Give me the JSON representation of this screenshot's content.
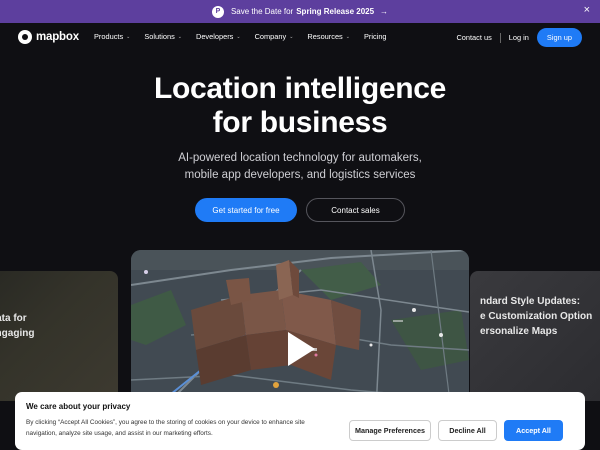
{
  "banner": {
    "badge": "P",
    "text": "Save the Date for",
    "highlight": "Spring Release 2025",
    "arrow": "→",
    "close": "×"
  },
  "nav": {
    "brand": "mapbox",
    "items": [
      {
        "label": "Products",
        "caret": "⌄"
      },
      {
        "label": "Solutions",
        "caret": "⌄"
      },
      {
        "label": "Developers",
        "caret": "⌄"
      },
      {
        "label": "Company",
        "caret": "⌄"
      },
      {
        "label": "Resources",
        "caret": "⌄"
      },
      {
        "label": "Pricing",
        "caret": ""
      }
    ],
    "contact": "Contact us",
    "login": "Log in",
    "signup": "Sign up"
  },
  "hero": {
    "title_line1": "Location intelligence",
    "title_line2": "for business",
    "subtitle_line1": "AI-powered location technology for automakers,",
    "subtitle_line2": "mobile app developers, and logistics services",
    "cta_primary": "Get started for free",
    "cta_secondary": "Contact sales"
  },
  "carousel": {
    "left_card": {
      "line1": "data for",
      "line2": "engaging"
    },
    "right_card": {
      "line1": "ndard Style Updates:",
      "line2": "e Customization Option",
      "line3": "ersonalize Maps"
    },
    "video": {
      "icon": "play-icon"
    }
  },
  "cookie": {
    "title": "We care about your privacy",
    "text": "By clicking “Accept All Cookies”, you agree to the storing of cookies on your device to enhance site navigation, analyze site usage, and assist in our marketing efforts.",
    "manage": "Manage Preferences",
    "decline": "Decline All",
    "accept": "Accept All"
  },
  "colors": {
    "banner_bg": "#5d3f9e",
    "accent": "#1f7bf6",
    "page_bg": "#0f0f13"
  }
}
